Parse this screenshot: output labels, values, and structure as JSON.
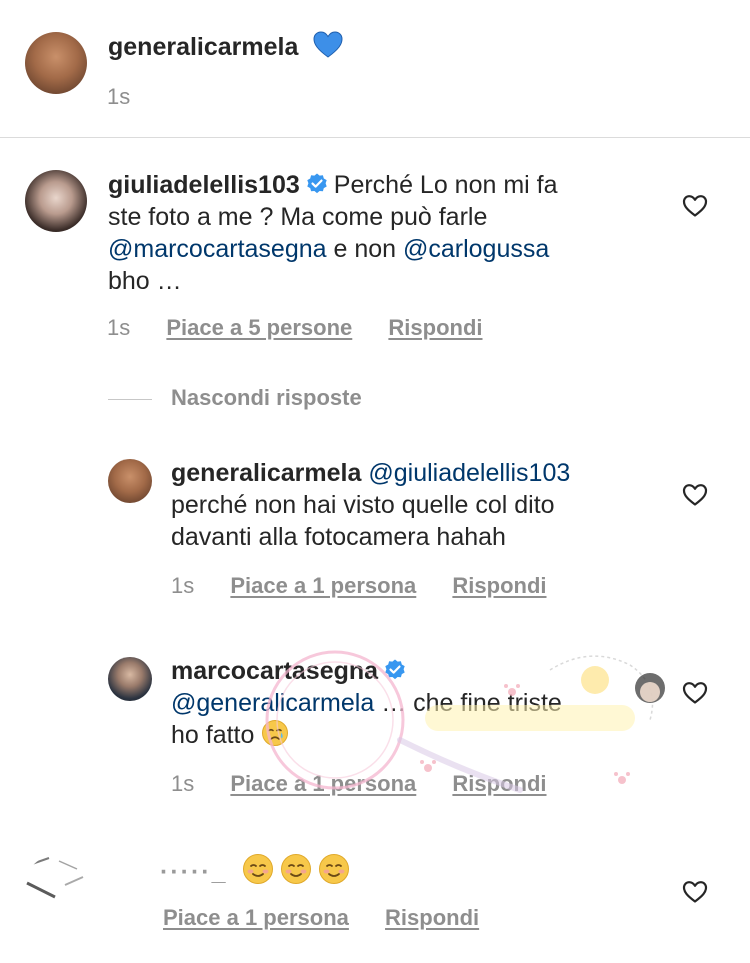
{
  "post": {
    "username": "generalicarmela",
    "emoji": "💙",
    "time": "1s"
  },
  "comments": [
    {
      "username": "giuliadelellis103",
      "verified": true,
      "text_1": "Perché Lo non mi fa",
      "text_2": "ste foto a me ? Ma come può farle",
      "mention_1": "@marcocartasegna",
      "text_3": " e non ",
      "mention_2": "@carlogussa",
      "text_4": "bho …",
      "time": "1s",
      "likes": "Piace a 5 persone",
      "reply": "Rispondi"
    }
  ],
  "hide_replies": "Nascondi risposte",
  "replies": [
    {
      "username": "generalicarmela",
      "mention": "@giuliadelellis103",
      "text_1": "perché non hai visto quelle col dito",
      "text_2": "davanti alla fotocamera hahah",
      "time": "1s",
      "likes": "Piace a 1 persona",
      "reply": "Rispondi"
    },
    {
      "username": "marcocartasegna",
      "verified": true,
      "mention": "@generalicarmela",
      "text_1": " … che fine triste",
      "text_2": "ho fatto",
      "time": "1s",
      "likes": "Piace a 1 persona",
      "reply": "Rispondi"
    }
  ],
  "last_comment": {
    "username": "·····_",
    "emojis": "☺ ☺ ☺",
    "likes": "Piace a 1 persona",
    "reply": "Rispondi"
  },
  "colors": {
    "text": "#262626",
    "muted": "#8e8e8e",
    "mention": "#00376b",
    "verified": "#3897f0",
    "heart_blue": "#3d8fe8"
  }
}
